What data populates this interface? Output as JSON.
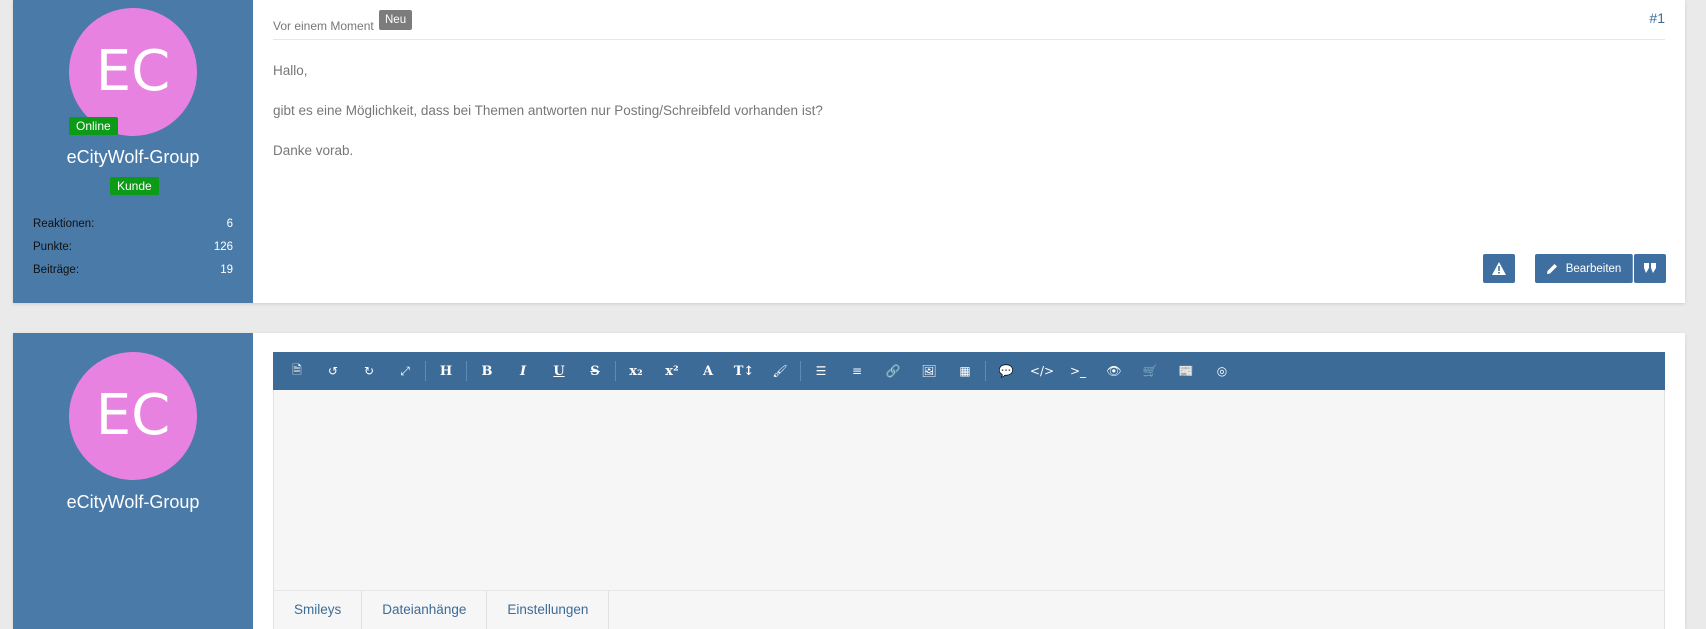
{
  "post": {
    "avatar_initials": "EC",
    "avatar_color": "#e882e0",
    "online_badge": "Online",
    "username": "eCityWolf-Group",
    "rank_badge": "Kunde",
    "stats": [
      {
        "label": "Reaktionen:",
        "value": "6"
      },
      {
        "label": "Punkte:",
        "value": "126"
      },
      {
        "label": "Beiträge:",
        "value": "19"
      }
    ],
    "time": "Vor einem Moment",
    "new_badge": "Neu",
    "number": "#1",
    "paragraphs": [
      "Hallo,",
      "gibt es eine Möglichkeit, dass bei Themen antworten nur Posting/Schreibfeld vorhanden ist?",
      "Danke vorab."
    ],
    "edit_label": "Bearbeiten"
  },
  "reply": {
    "avatar_initials": "EC",
    "username": "eCityWolf-Group",
    "tabs": [
      "Smileys",
      "Dateianhänge",
      "Einstellungen"
    ]
  },
  "colors": {
    "sidebar": "#4a7aa8",
    "toolbar": "#3d6b97",
    "badge_green": "#0c9b17",
    "link": "#3a6d9e"
  }
}
